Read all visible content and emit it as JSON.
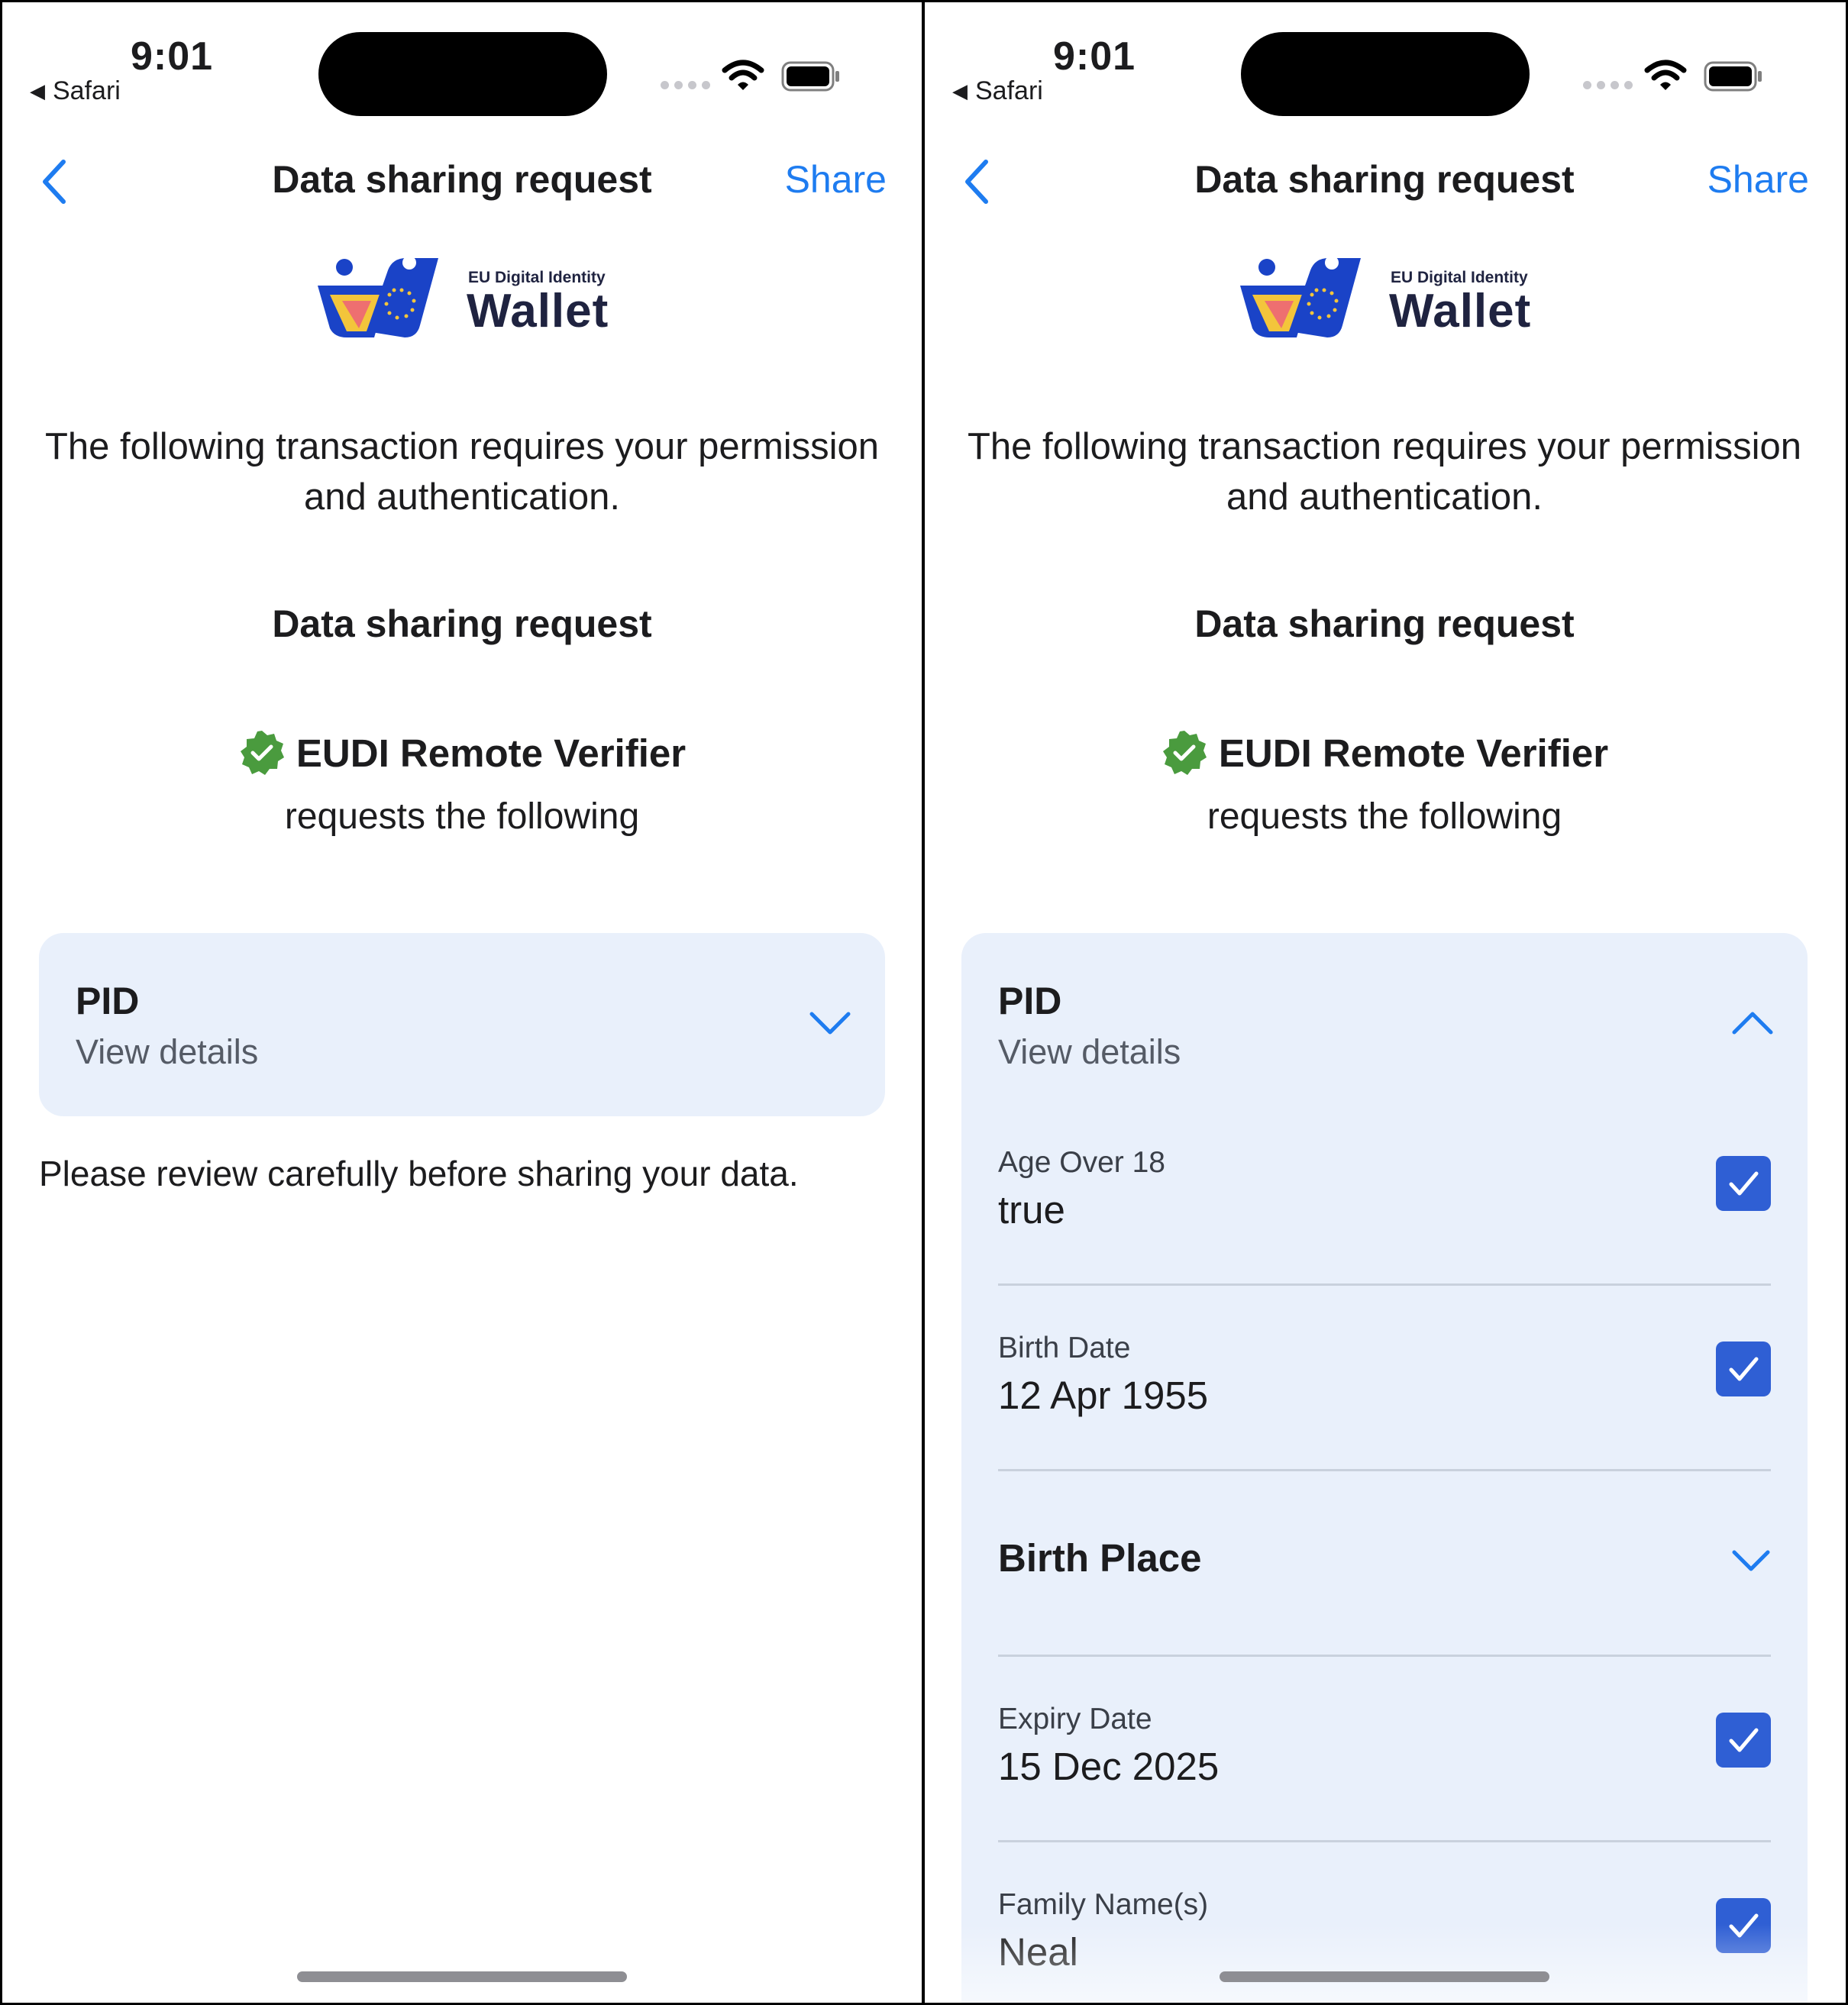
{
  "status_bar": {
    "time": "9:01",
    "back_app": "Safari"
  },
  "nav": {
    "title": "Data sharing request",
    "share_label": "Share"
  },
  "logo": {
    "subtitle": "EU Digital Identity",
    "title": "Wallet"
  },
  "intro_text": "The following transaction requires your permission and authentication.",
  "section_title": "Data sharing request",
  "verifier": {
    "name": "EUDI Remote Verifier",
    "requests": "requests the following"
  },
  "card": {
    "title": "PID",
    "subtitle": "View details"
  },
  "review_note": "Please review carefully before sharing your data.",
  "fields": [
    {
      "label": "Age Over 18",
      "value": "true",
      "checked": true
    },
    {
      "label": "Birth Date",
      "value": "12 Apr 1955",
      "checked": true
    },
    {
      "group": "Birth Place",
      "collapsed": true
    },
    {
      "label": "Expiry Date",
      "value": "15 Dec 2025",
      "checked": true
    },
    {
      "label": "Family Name(s)",
      "value": "Neal",
      "checked": true
    }
  ],
  "colors": {
    "accent": "#1e7cf0",
    "card_bg": "#e9f0fb",
    "checkbox": "#2f5fd4",
    "verified": "#4a9b3e"
  },
  "icons": [
    "back-chevron-icon",
    "wifi-icon",
    "battery-icon",
    "verified-badge-icon",
    "chevron-down-icon",
    "chevron-up-icon",
    "checkbox-checked-icon"
  ]
}
